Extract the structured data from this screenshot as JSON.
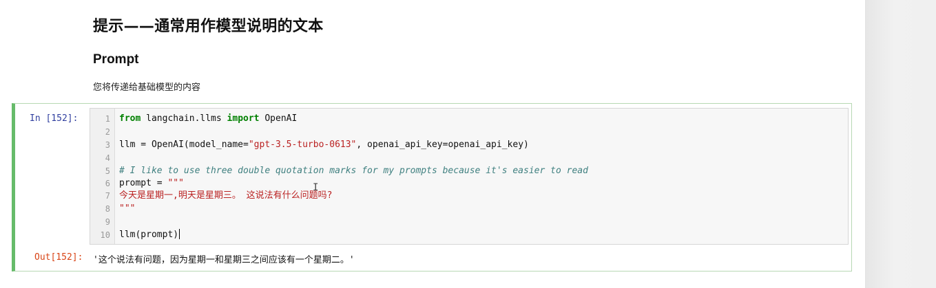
{
  "markdown": {
    "title": "提示——通常用作模型说明的文本",
    "subtitle": "Prompt",
    "description": "您将传递给基础模型的内容"
  },
  "cell": {
    "in_prompt": "In [152]:",
    "out_prompt": "Out[152]:",
    "line_numbers": [
      "1",
      "2",
      "3",
      "4",
      "5",
      "6",
      "7",
      "8",
      "9",
      "10"
    ],
    "code": {
      "line1_kw_from": "from",
      "line1_module": " langchain.llms ",
      "line1_kw_import": "import",
      "line1_name": " OpenAI",
      "line3_pre": "llm = OpenAI(model_name=",
      "line3_str": "\"gpt-3.5-turbo-0613\"",
      "line3_post": ", openai_api_key=openai_api_key)",
      "line5_comment": "# I like to use three double quotation marks for my prompts because it's easier to read",
      "line6_pre": "prompt = ",
      "line6_str": "\"\"\"",
      "line7_str": "今天是星期一,明天是星期三。 这说法有什么问题吗?",
      "line8_str": "\"\"\"",
      "line10": "llm(prompt)"
    },
    "output": "'这个说法有问题，因为星期一和星期三之间应该有一个星期二。'"
  },
  "colors": {
    "cell_border_active": "#66bb6a",
    "keyword": "#008000",
    "string": "#ba2121",
    "comment": "#408080",
    "in_prompt": "#303f9f",
    "out_prompt": "#d84315"
  }
}
